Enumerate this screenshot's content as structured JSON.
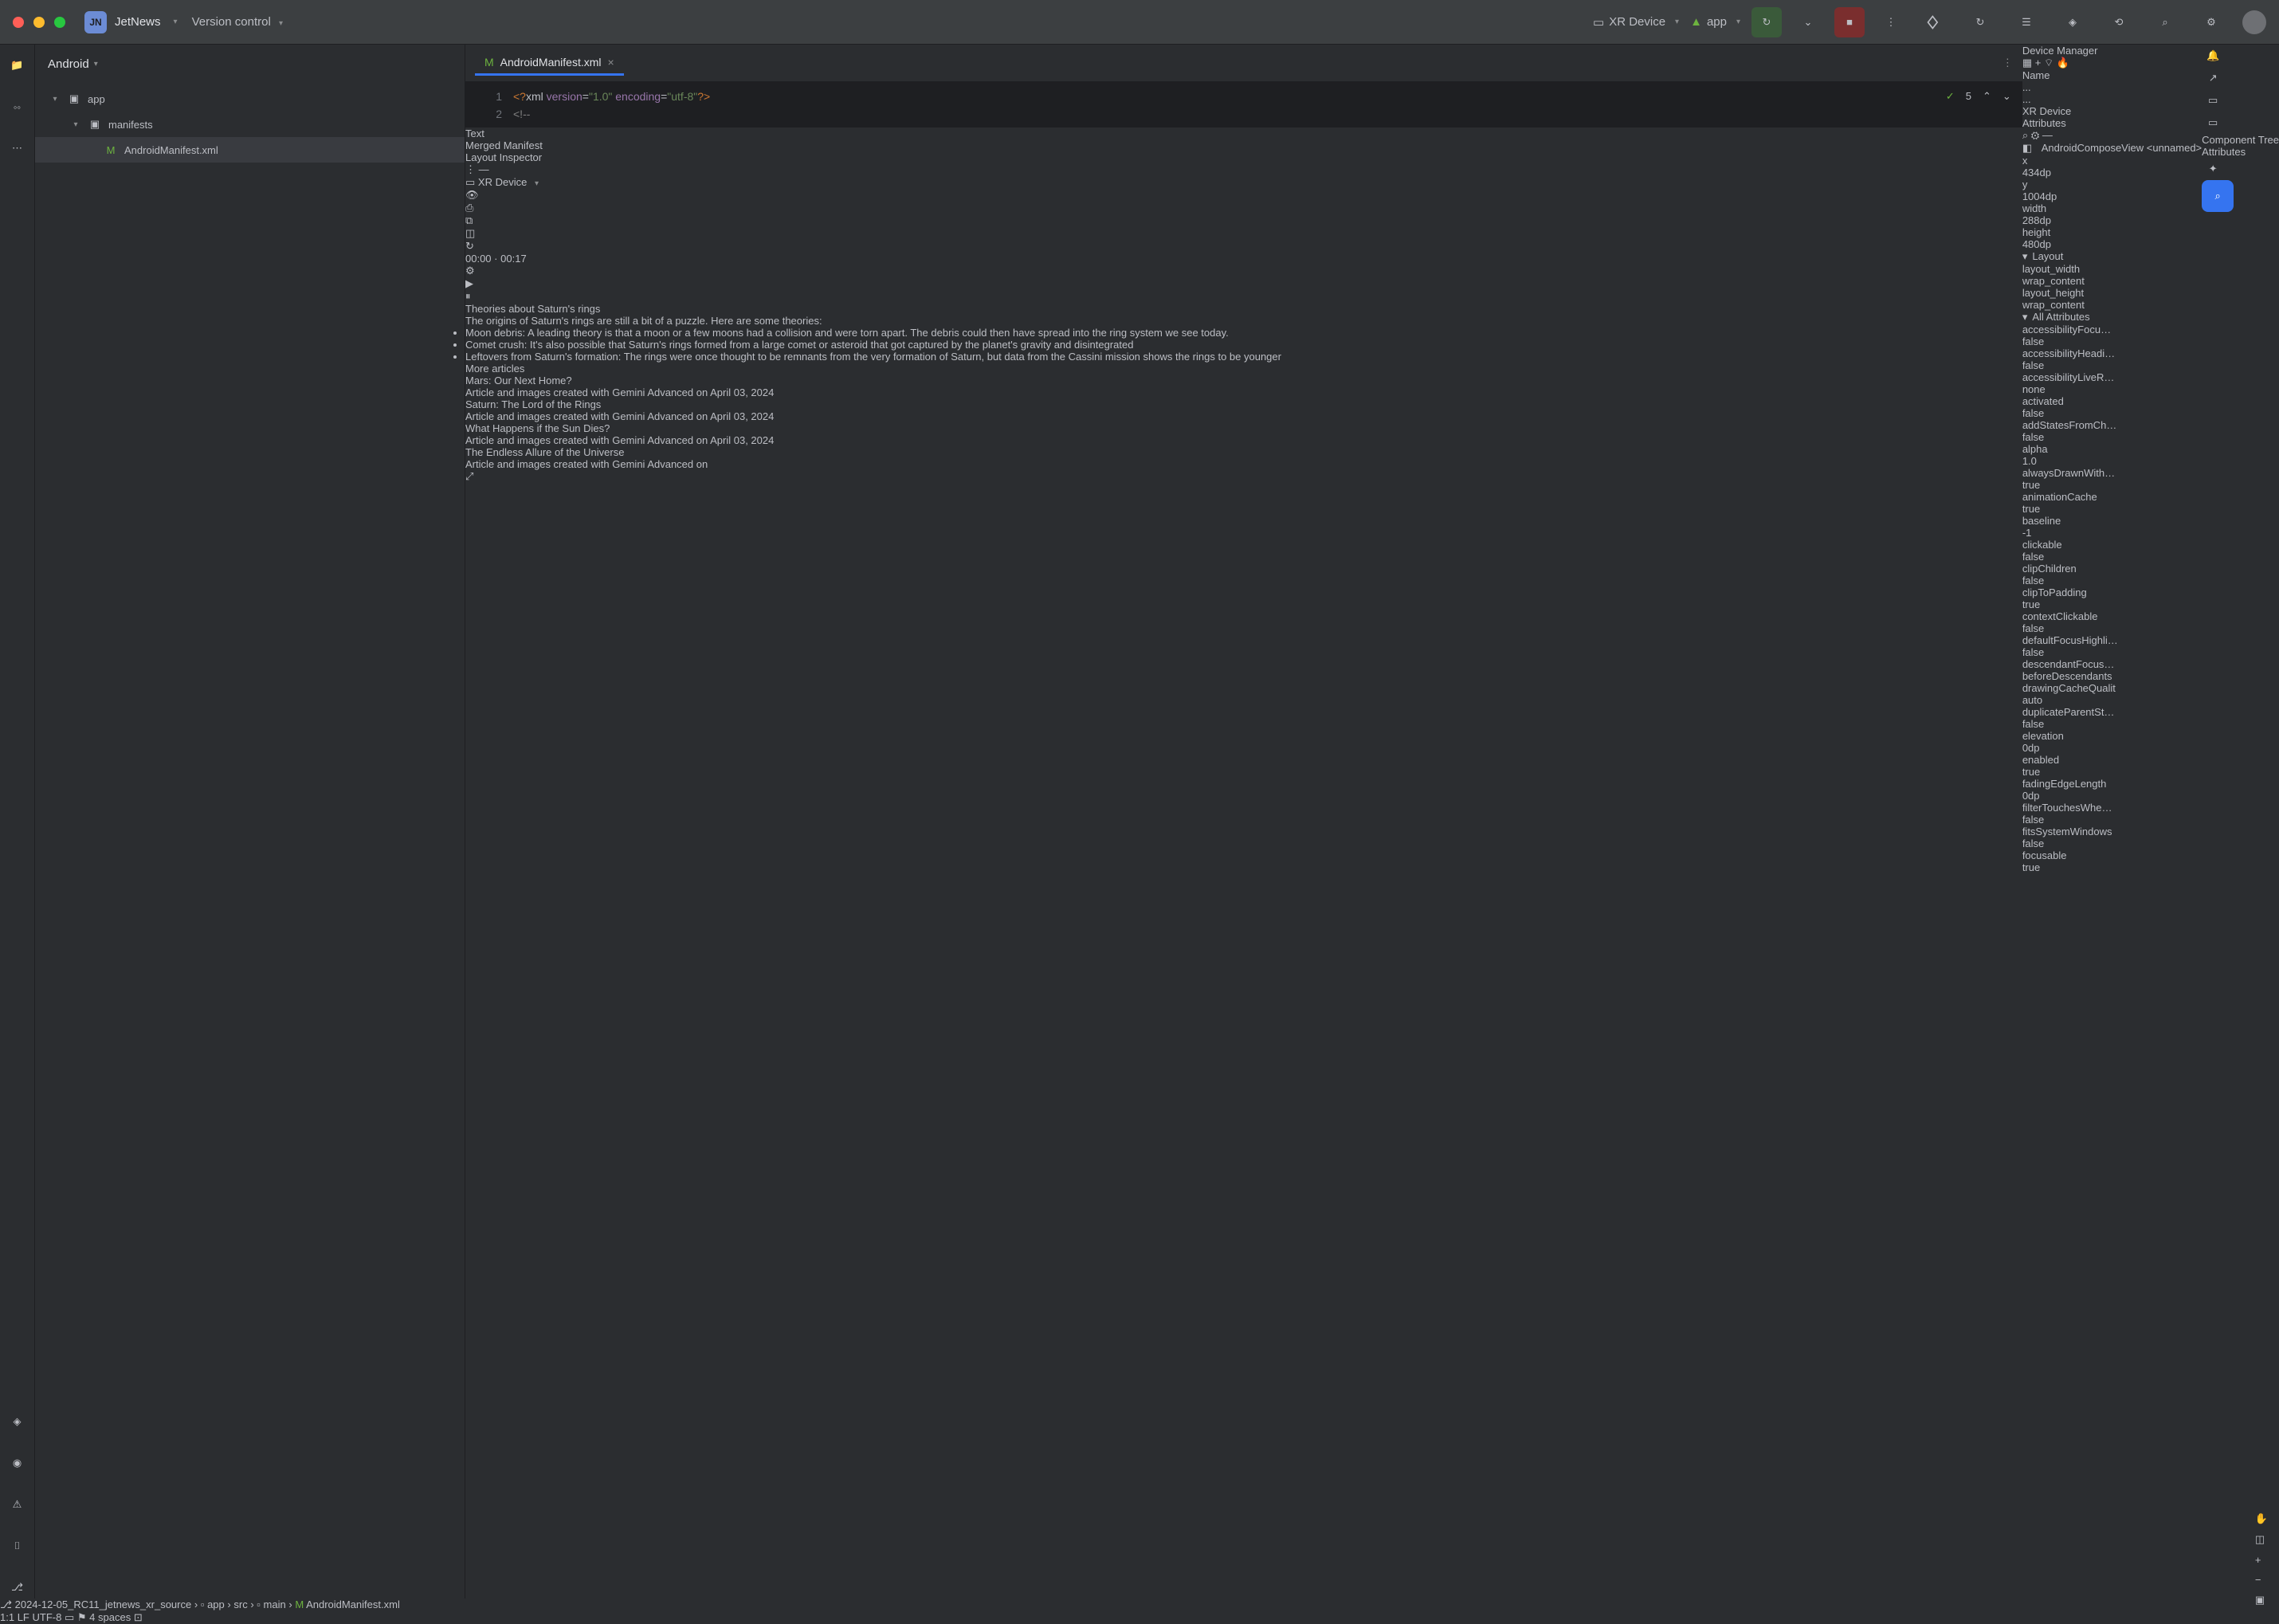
{
  "titlebar": {
    "project_badge": "JN",
    "project_name": "JetNews",
    "version_control": "Version control",
    "xr_device": "XR Device",
    "app_config": "app"
  },
  "project_panel": {
    "header": "Android",
    "tree": {
      "app": "app",
      "manifests": "manifests",
      "manifest_file": "AndroidManifest.xml"
    }
  },
  "editor": {
    "tab_name": "AndroidManifest.xml",
    "status_count": "5",
    "line1_num": "1",
    "line1_code": "<?xml version=\"1.0\" encoding=\"utf-8\"?>",
    "line2_num": "2",
    "line2_code": "<!--",
    "subtab_text": "Text",
    "subtab_merged": "Merged Manifest"
  },
  "layout_inspector": {
    "title": "Layout Inspector",
    "device_sel": "XR Device"
  },
  "preview": {
    "video": {
      "current": "00:00",
      "total": "00:17"
    },
    "card1": {
      "title": "Theories about Saturn's rings",
      "subtitle": "The origins of Saturn's rings are still a bit of a puzzle. Here are some theories:",
      "b1": "Moon debris: A leading theory is that a moon or a few moons had a collision and were torn apart. The debris could then have spread into the ring system we see today.",
      "b2": "Comet crush: It's also possible that Saturn's rings formed from a large comet or asteroid that got captured by the planet's gravity and disintegrated",
      "b3": "Leftovers from Saturn's formation: The rings were once thought to be remnants from the very formation of Saturn, but data from the Cassini mission shows the rings to be younger"
    },
    "more": {
      "title": "More articles",
      "items": [
        {
          "title": "Mars: Our Next Home?",
          "sub": "Article and images created with Gemini Advanced on April 03, 2024"
        },
        {
          "title": "Saturn: The Lord of the Rings",
          "sub": "Article and images created with Gemini Advanced on April 03, 2024"
        },
        {
          "title": "What Happens if the Sun Dies?",
          "sub": "Article and images created with Gemini Advanced on April 03, 2024"
        },
        {
          "title": "The Endless Allure of the Universe",
          "sub": "Article and images created with Gemini Advanced on"
        }
      ]
    }
  },
  "device_manager": {
    "title": "Device Manager",
    "col_name": "Name",
    "col_a": "...",
    "col_b": "...",
    "row_device": "XR Device"
  },
  "attributes": {
    "title": "Attributes",
    "element": "AndroidComposeView",
    "unnamed": "<unnamed>",
    "basic": [
      {
        "k": "x",
        "v": "434dp"
      },
      {
        "k": "y",
        "v": "1004dp"
      },
      {
        "k": "width",
        "v": "288dp"
      },
      {
        "k": "height",
        "v": "480dp"
      }
    ],
    "layout_section": "Layout",
    "layout": [
      {
        "k": "layout_width",
        "v": "wrap_content"
      },
      {
        "k": "layout_height",
        "v": "wrap_content"
      }
    ],
    "all_section": "All Attributes",
    "all": [
      {
        "k": "accessibilityFocu…",
        "v": "false"
      },
      {
        "k": "accessibilityHeadi…",
        "v": "false"
      },
      {
        "k": "accessibilityLiveR…",
        "v": "none"
      },
      {
        "k": "activated",
        "v": "false"
      },
      {
        "k": "addStatesFromCh…",
        "v": "false"
      },
      {
        "k": "alpha",
        "v": "1.0"
      },
      {
        "k": "alwaysDrawnWith…",
        "v": "true"
      },
      {
        "k": "animationCache",
        "v": "true"
      },
      {
        "k": "baseline",
        "v": "-1"
      },
      {
        "k": "clickable",
        "v": "false"
      },
      {
        "k": "clipChildren",
        "v": "false"
      },
      {
        "k": "clipToPadding",
        "v": "true"
      },
      {
        "k": "contextClickable",
        "v": "false"
      },
      {
        "k": "defaultFocusHighli…",
        "v": "false"
      },
      {
        "k": "descendantFocus…",
        "v": "beforeDescendants"
      },
      {
        "k": "drawingCacheQualit",
        "v": "auto"
      },
      {
        "k": "duplicateParentSt…",
        "v": "false"
      },
      {
        "k": "elevation",
        "v": "0dp"
      },
      {
        "k": "enabled",
        "v": "true"
      },
      {
        "k": "fadingEdgeLength",
        "v": "0dp"
      },
      {
        "k": "filterTouchesWhe…",
        "v": "false"
      },
      {
        "k": "fitsSystemWindows",
        "v": "false"
      },
      {
        "k": "focusable",
        "v": "true"
      }
    ]
  },
  "right_tool": {
    "component_tree": "Component Tree",
    "attributes": "Attributes"
  },
  "statusbar": {
    "branch": "2024-12-05_RC11_jetnews_xr_source",
    "crumb_app": "app",
    "crumb_src": "src",
    "crumb_main": "main",
    "crumb_file": "AndroidManifest.xml",
    "pos": "1:1",
    "le": "LF",
    "enc": "UTF-8",
    "indent": "4 spaces"
  }
}
